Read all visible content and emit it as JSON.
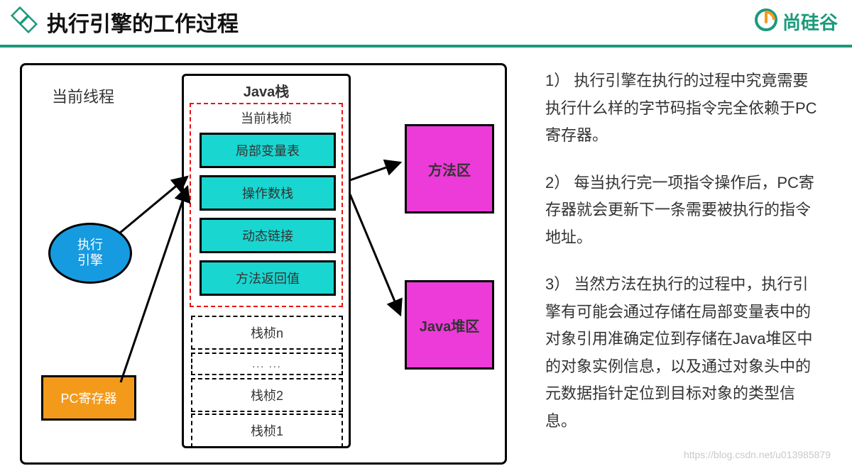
{
  "header": {
    "title": "执行引擎的工作过程",
    "brand": "尚硅谷"
  },
  "diagram": {
    "thread_label": "当前线程",
    "java_stack_label": "Java栈",
    "current_frame_label": "当前栈桢",
    "cells": {
      "local_vars": "局部变量表",
      "operand_stack": "操作数栈",
      "dynamic_link": "动态链接",
      "return_value": "方法返回值"
    },
    "frames": {
      "frame_n": "栈桢n",
      "ellipsis": "... ...",
      "frame_2": "栈桢2",
      "frame_1": "栈桢1"
    },
    "exec_engine": "执行\n引擎",
    "pc_register": "PC寄存器",
    "method_area": "方法区",
    "heap_area": "Java堆区"
  },
  "description": {
    "p1": "1） 执行引擎在执行的过程中究竟需要执行什么样的字节码指令完全依赖于PC寄存器。",
    "p2": "2） 每当执行完一项指令操作后，PC寄存器就会更新下一条需要被执行的指令地址。",
    "p3": "3） 当然方法在执行的过程中，执行引擎有可能会通过存储在局部变量表中的对象引用准确定位到存储在Java堆区中的对象实例信息，以及通过对象头中的元数据指针定位到目标对象的类型信息。"
  },
  "watermark": "https://blog.csdn.net/u013985879"
}
